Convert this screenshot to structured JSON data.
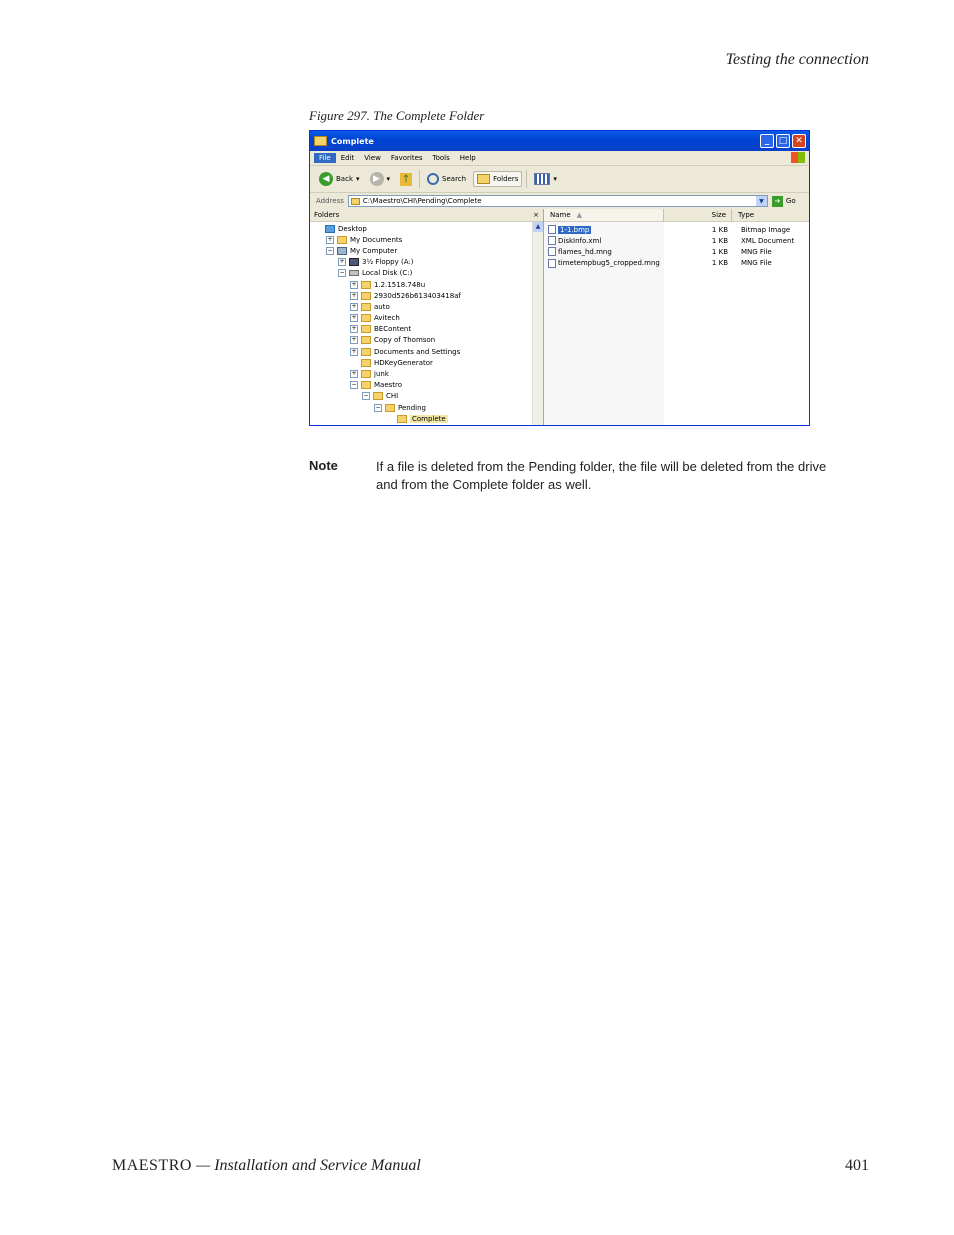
{
  "page": {
    "header_title": "Testing the connection",
    "figure_caption": "Figure 297.  The Complete Folder",
    "note_label": "Note",
    "note_text": "If a file is deleted from the Pending folder, the file will be deleted from the drive and from the Complete folder as well.",
    "footer_product": "MAESTRO",
    "footer_dash": " — ",
    "footer_manual": "Installation and Service Manual",
    "page_number": "401"
  },
  "window": {
    "title": "Complete",
    "menu": [
      "File",
      "Edit",
      "View",
      "Favorites",
      "Tools",
      "Help"
    ],
    "toolbar": {
      "back": "Back",
      "search": "Search",
      "folders": "Folders"
    },
    "address_label": "Address",
    "address_value": "C:\\Maestro\\CHI\\Pending\\Complete",
    "go_label": "Go",
    "folders_pane_title": "Folders",
    "folders_close": "×",
    "columns": {
      "name": "Name",
      "size": "Size",
      "type": "Type"
    },
    "tree": [
      {
        "label": "Desktop",
        "level": 0,
        "pm": "",
        "icon": "desktop"
      },
      {
        "label": "My Documents",
        "level": 1,
        "pm": "+",
        "icon": "mydocs"
      },
      {
        "label": "My Computer",
        "level": 1,
        "pm": "−",
        "icon": "computer"
      },
      {
        "label": "3½ Floppy (A:)",
        "level": 2,
        "pm": "+",
        "icon": "floppy"
      },
      {
        "label": "Local Disk (C:)",
        "level": 2,
        "pm": "−",
        "icon": "disk"
      },
      {
        "label": "1.2.1518.748u",
        "level": 3,
        "pm": "+",
        "icon": "folder"
      },
      {
        "label": "2930d526b613403418af",
        "level": 3,
        "pm": "+",
        "icon": "folder"
      },
      {
        "label": "auto",
        "level": 3,
        "pm": "+",
        "icon": "folder"
      },
      {
        "label": "Avitech",
        "level": 3,
        "pm": "+",
        "icon": "folder"
      },
      {
        "label": "BEContent",
        "level": 3,
        "pm": "+",
        "icon": "folder"
      },
      {
        "label": "Copy of Thomson",
        "level": 3,
        "pm": "+",
        "icon": "folder"
      },
      {
        "label": "Documents and Settings",
        "level": 3,
        "pm": "+",
        "icon": "folder"
      },
      {
        "label": "HDKeyGenerator",
        "level": 3,
        "pm": "",
        "icon": "folder"
      },
      {
        "label": "junk",
        "level": 3,
        "pm": "+",
        "icon": "folder"
      },
      {
        "label": "Maestro",
        "level": 3,
        "pm": "−",
        "icon": "folder"
      },
      {
        "label": "CHI",
        "level": 4,
        "pm": "−",
        "icon": "folder"
      },
      {
        "label": "Pending",
        "level": 5,
        "pm": "−",
        "icon": "folder"
      },
      {
        "label": "Complete",
        "level": 6,
        "pm": "",
        "icon": "folder",
        "selected": true
      }
    ],
    "files": [
      {
        "name": "1-1.bmp",
        "size": "1 KB",
        "type": "Bitmap Image",
        "selected": true
      },
      {
        "name": "DiskInfo.xml",
        "size": "1 KB",
        "type": "XML Document"
      },
      {
        "name": "flames_hd.mng",
        "size": "1 KB",
        "type": "MNG File"
      },
      {
        "name": "timetempbug5_cropped.mng",
        "size": "1 KB",
        "type": "MNG File"
      }
    ]
  }
}
